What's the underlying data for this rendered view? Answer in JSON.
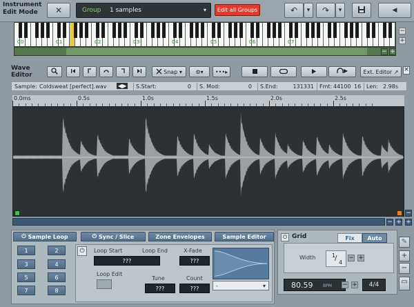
{
  "app": {
    "mode_title_line1": "Instrument",
    "mode_title_line2": "Edit Mode"
  },
  "topbar": {
    "close_glyph": "✕",
    "group_label": "Group",
    "samples_count": "1 samples",
    "edit_all_groups": "Edit all Groups",
    "undo_glyph": "↶",
    "redo_glyph": "↷",
    "dropdown_glyph": "▾",
    "save_glyph": "💾",
    "nav_left_glyph": "◀"
  },
  "keyboard": {
    "octave_labels": [
      "C0",
      "C1",
      "C2",
      "C3",
      "C4",
      "C5",
      "C6",
      "C7"
    ],
    "minus_label": "−",
    "plus_label": "+"
  },
  "wave_editor": {
    "title_line1": "Wave",
    "title_line2": "Editor",
    "snap_label": "Snap ▾",
    "ext_editor_label": "Ext. Editor ↗",
    "close_label": "×",
    "info": {
      "sample_label": "Sample:",
      "sample_name": "Coldsweat [perfect].wav",
      "s_start_label": "S.Start:",
      "s_start_value": "0",
      "s_mod_label": "S. Mod:",
      "s_mod_value": "0",
      "s_end_label": "S.End:",
      "s_end_value": "131331",
      "fmt_label": "Fmt:",
      "fmt_rate": "44100",
      "fmt_bits": "16",
      "len_label": "Len:",
      "len_value": "2.98s"
    },
    "ruler_labels": [
      "0.0ms",
      "0.5s",
      "1.0s",
      "1.5s",
      "2.0s",
      "2.5s"
    ],
    "scroll_minus": "−",
    "scroll_plus": "+"
  },
  "sample_loop": {
    "tabs": [
      "Sample Loop",
      "Sync / Slice",
      "Zone Envelopes",
      "Sample Editor"
    ],
    "loop_numbers": [
      "1",
      "2",
      "3",
      "4",
      "5",
      "6",
      "7",
      "8"
    ],
    "loop_start_label": "Loop Start",
    "loop_end_label": "Loop End",
    "xfade_label": "X-Fade",
    "loop_edit_label": "Loop Edit",
    "tune_label": "Tune",
    "count_label": "Count",
    "value_placeholder": "???",
    "curve_select_value": "-"
  },
  "grid": {
    "title": "Grid",
    "fix_tab": "Fix",
    "auto_tab": "Auto",
    "width_label": "Width",
    "width_numerator": "1",
    "width_denominator": "4",
    "bpm_value": "80.59",
    "bpm_unit": "BPM",
    "sig_numerator": "4",
    "sig_denominator": "4",
    "minus_label": "−",
    "plus_label": "+"
  },
  "colors": {
    "accent_green": "#8fd16f",
    "edit_all_red": "#e23b2e",
    "waveform_bg": "#2d3133",
    "waveform_fill": "#9aa0a4",
    "tab_blue": "#5f7b96"
  }
}
